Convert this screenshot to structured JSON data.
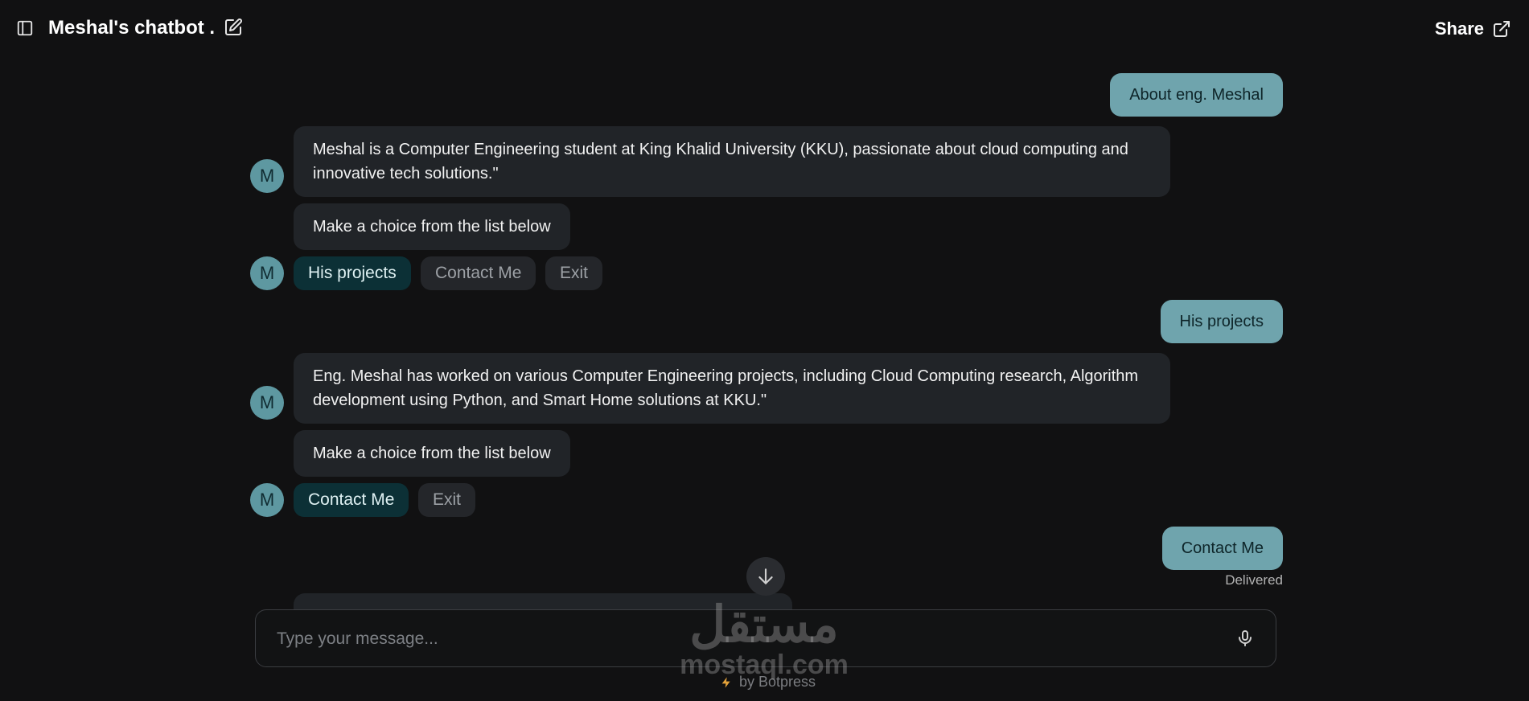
{
  "header": {
    "title": "Meshal's chatbot .",
    "share_label": "Share"
  },
  "bot": {
    "avatar_initial": "M"
  },
  "messages": {
    "user_1": "About eng. Meshal",
    "bot_1": "Meshal is a Computer Engineering student at King Khalid University (KKU), passionate about cloud computing and innovative tech solutions.\"",
    "prompt_1": "Make a choice from the list below",
    "choices_1": [
      "His projects",
      "Contact Me",
      "Exit"
    ],
    "user_2": "His projects",
    "bot_2": "Eng. Meshal has worked on various Computer Engineering projects, including Cloud Computing research, Algorithm development using Python, and Smart Home solutions at KKU.\"",
    "prompt_2": "Make a choice from the list below",
    "choices_2": [
      "Contact Me",
      "Exit"
    ],
    "user_3": "Contact Me",
    "status": "Delivered"
  },
  "composer": {
    "placeholder": "Type your message..."
  },
  "footer": {
    "powered_by": "by Botpress"
  },
  "watermark": {
    "arabic": "مستقل",
    "latin": "mostaql.com"
  },
  "colors": {
    "background": "#111112",
    "user_bubble": "#6fa4ad",
    "bot_bubble": "#212428",
    "selected_choice": "#0c3036",
    "avatar": "#5e98a1"
  }
}
